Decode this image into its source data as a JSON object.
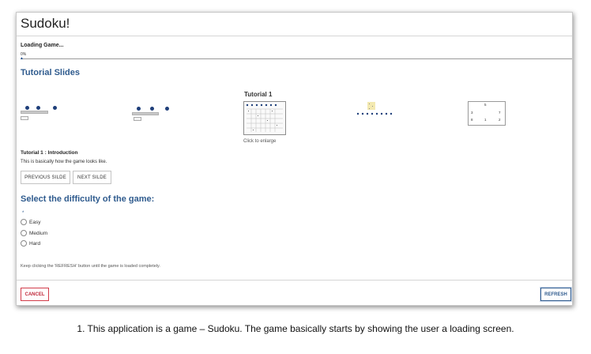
{
  "window": {
    "title": "Sudoku!"
  },
  "loading": {
    "label": "Loading Game...",
    "percent_text": "0%",
    "progress": 0
  },
  "tutorial": {
    "section_title": "Tutorial Slides",
    "current_slide_title": "Tutorial 1",
    "enlarge_label": "Click to enlarge",
    "subtitle": "Tutorial 1 : Introduction",
    "description": "This is basically how the game looks like.",
    "prev_label": "PREVIOUS SILDE",
    "next_label": "NEXT SILDE",
    "thumb5_numbers": [
      "5",
      "3",
      "7",
      "8",
      "1",
      "2"
    ]
  },
  "difficulty": {
    "title": "Select the difficulty of the game:",
    "required_mark": "*",
    "options": [
      "Easy",
      "Medium",
      "Hard"
    ]
  },
  "hint": "Keep clicking the 'REFRESH' button until the game is loaded completely.",
  "footer": {
    "cancel_label": "CANCEL",
    "refresh_label": "REFRESH"
  },
  "caption": "1. This application is a game – Sudoku. The game basically starts by showing the user a loading screen.",
  "colors": {
    "accent": "#2f5b8e",
    "cancel": "#c0283a",
    "progress_marker": "#1f4e8c"
  }
}
